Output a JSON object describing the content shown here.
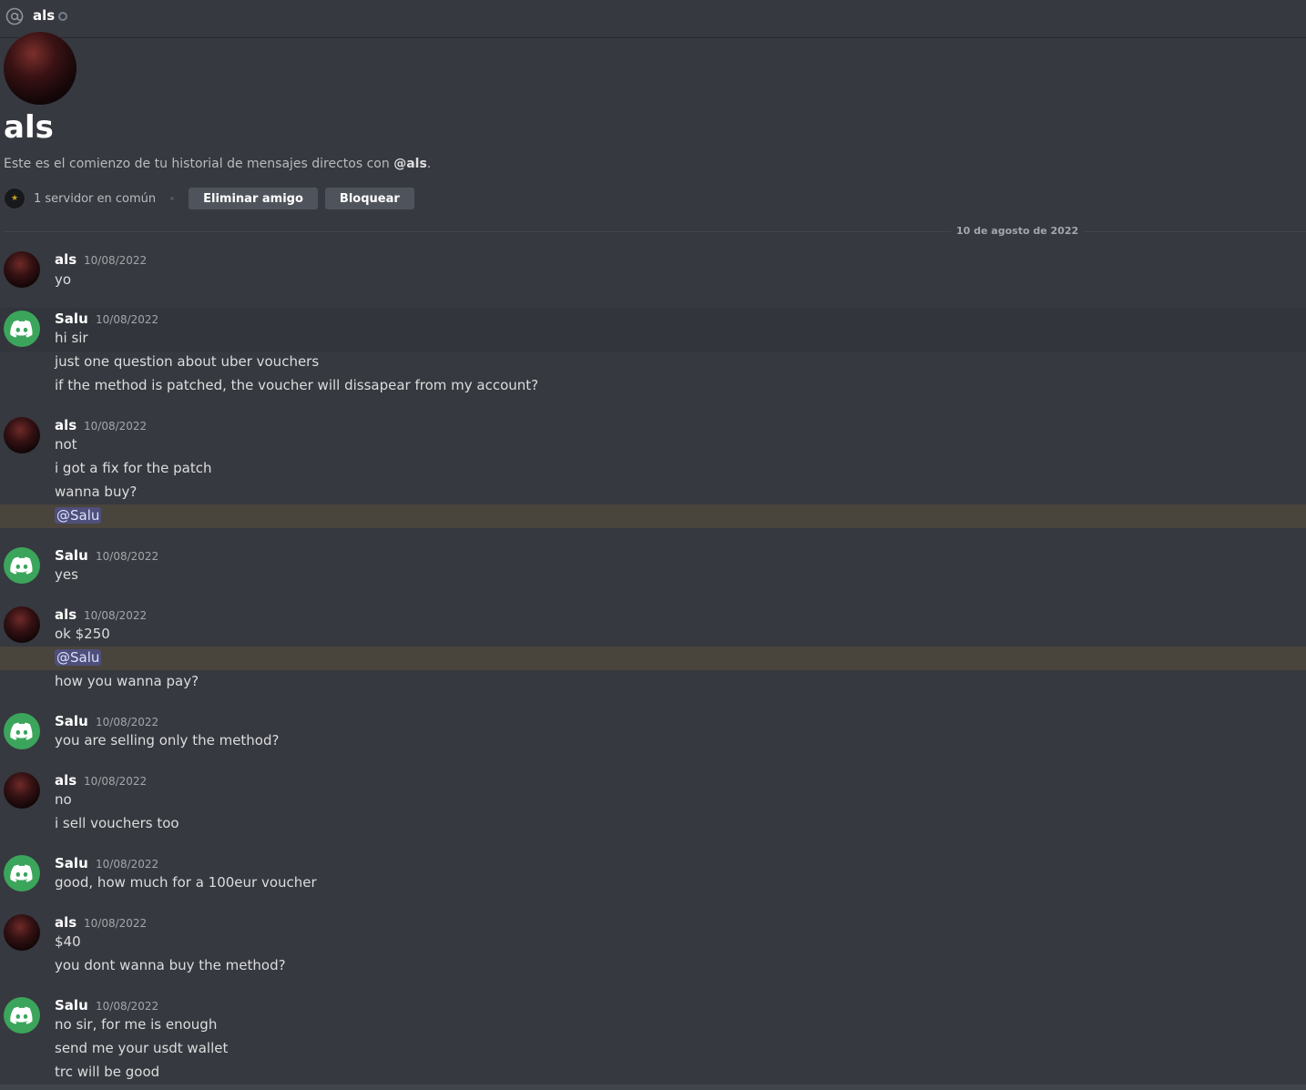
{
  "header": {
    "username": "als"
  },
  "intro": {
    "name": "als",
    "description_prefix": "Este es el comienzo de tu historial de mensajes directos con ",
    "description_handle": "@als",
    "description_suffix": ".",
    "mutual_servers": "1 servidor en común",
    "remove_friend_label": "Eliminar amigo",
    "block_label": "Bloquear"
  },
  "date_divider": "10 de agosto de 2022",
  "messages": [
    {
      "author": "als",
      "time": "10/08/2022",
      "lines": [
        "yo"
      ]
    },
    {
      "author": "Salu",
      "time": "10/08/2022",
      "lines": [
        "hi sir",
        "just one question about uber vouchers",
        "if the method is patched, the voucher will dissapear from my account?"
      ]
    },
    {
      "author": "als",
      "time": "10/08/2022",
      "lines": [
        "not",
        "i got a fix for the patch",
        "wanna buy?",
        "@Salu"
      ]
    },
    {
      "author": "Salu",
      "time": "10/08/2022",
      "lines": [
        "yes"
      ]
    },
    {
      "author": "als",
      "time": "10/08/2022",
      "lines": [
        "ok $250",
        "@Salu",
        "how you wanna pay?"
      ]
    },
    {
      "author": "Salu",
      "time": "10/08/2022",
      "lines": [
        "you are selling only the method?"
      ]
    },
    {
      "author": "als",
      "time": "10/08/2022",
      "lines": [
        "no",
        "i sell vouchers too"
      ]
    },
    {
      "author": "Salu",
      "time": "10/08/2022",
      "lines": [
        "good, how much for a 100eur voucher"
      ]
    },
    {
      "author": "als",
      "time": "10/08/2022",
      "lines": [
        "$40",
        "you dont wanna buy the method?"
      ]
    },
    {
      "author": "Salu",
      "time": "10/08/2022",
      "lines": [
        "no sir, for me is enough",
        "send me your usdt wallet",
        "trc will be good"
      ]
    }
  ]
}
